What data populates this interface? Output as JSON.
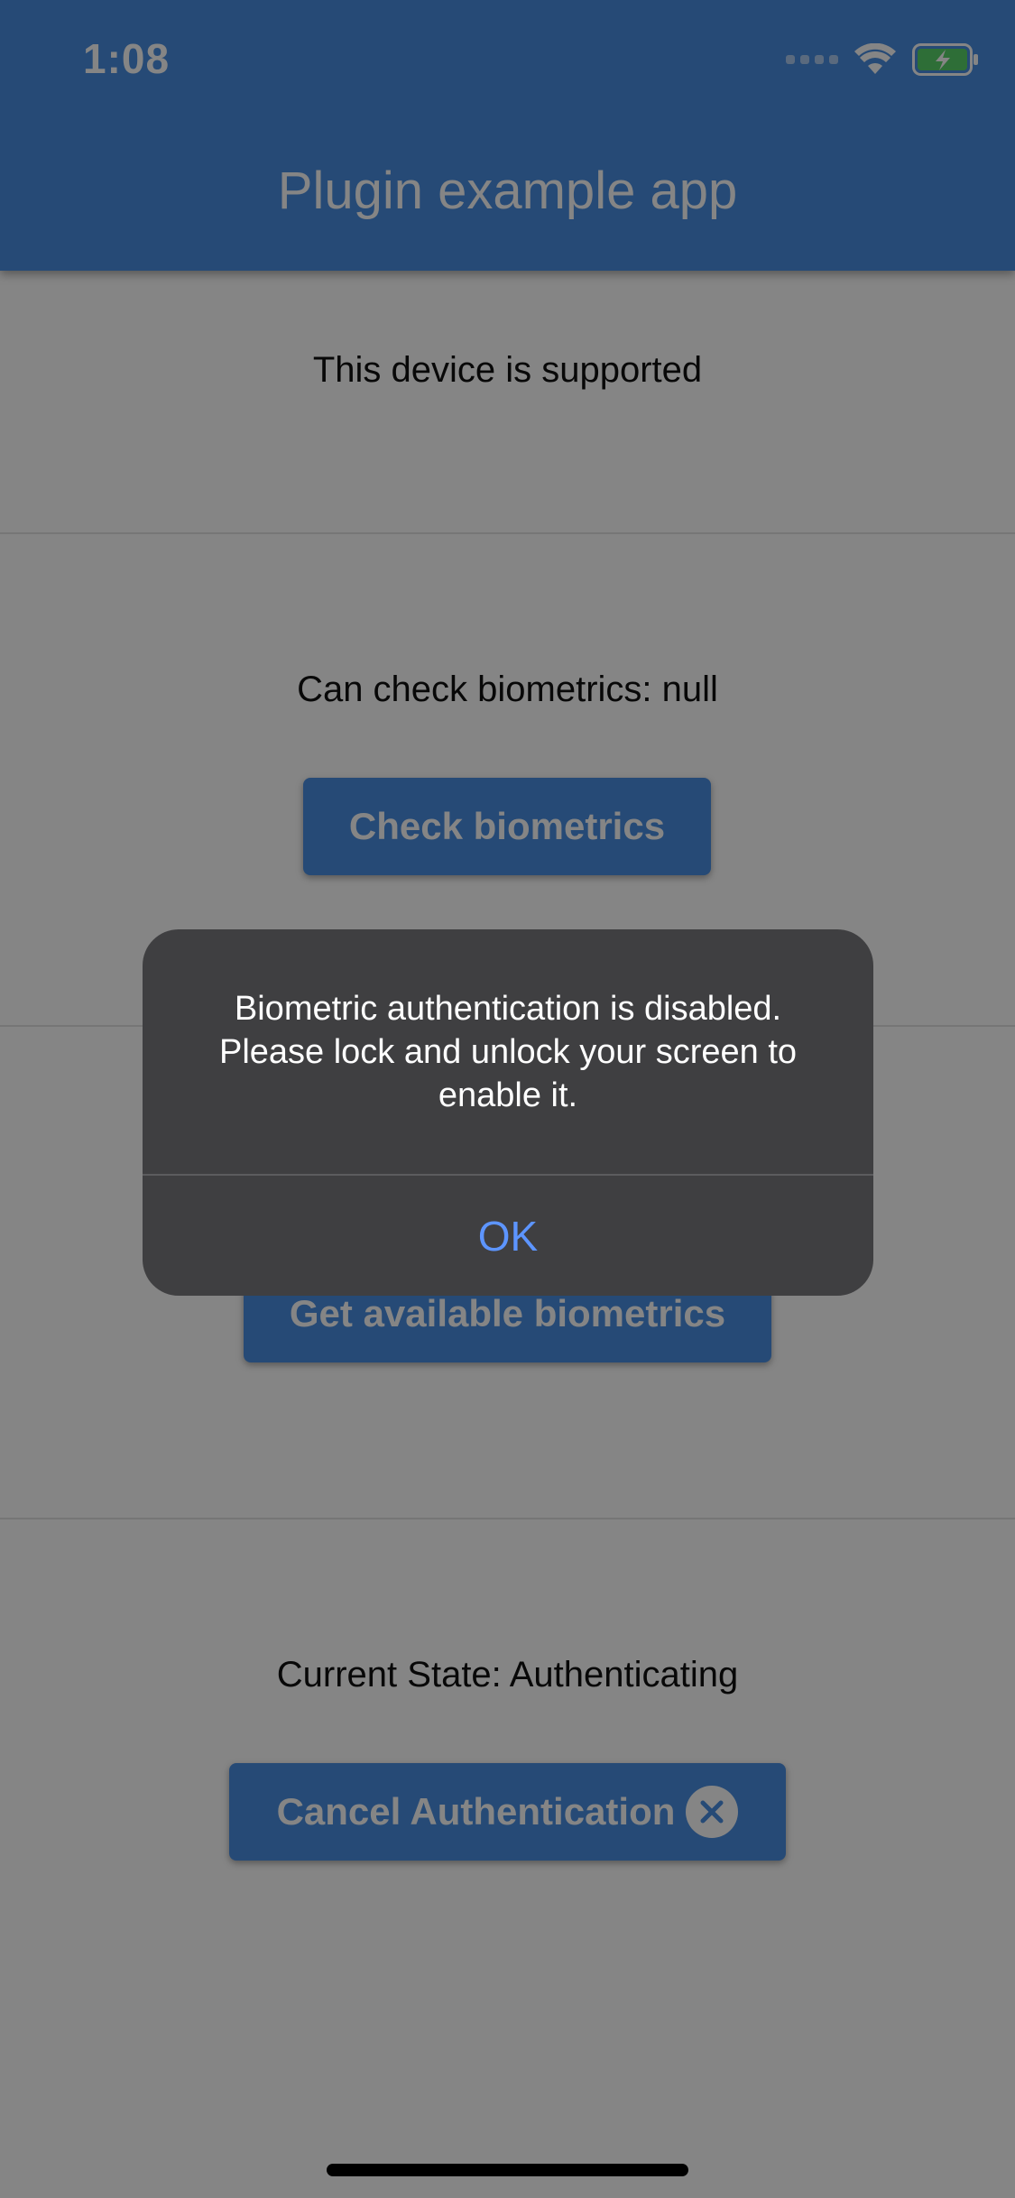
{
  "status_bar": {
    "time": "1:08",
    "wifi_icon": "wifi-icon",
    "battery_icon": "battery-charging-icon",
    "battery_color": "#58d46a"
  },
  "app_bar": {
    "title": "Plugin example app",
    "color": "#4a8fe2"
  },
  "sections": {
    "supported": {
      "text": "This device is supported"
    },
    "check": {
      "text": "Can check biometrics: null",
      "button": "Check biometrics"
    },
    "available": {
      "button": "Get available biometrics"
    },
    "state": {
      "text": "Current State: Authenticating",
      "button": "Cancel Authentication",
      "button_icon": "close-circle-icon"
    }
  },
  "dialog": {
    "message": "Biometric authentication is disabled. Please lock and unlock your screen to enable it.",
    "ok_label": "OK",
    "ok_color": "#5d95ff"
  }
}
